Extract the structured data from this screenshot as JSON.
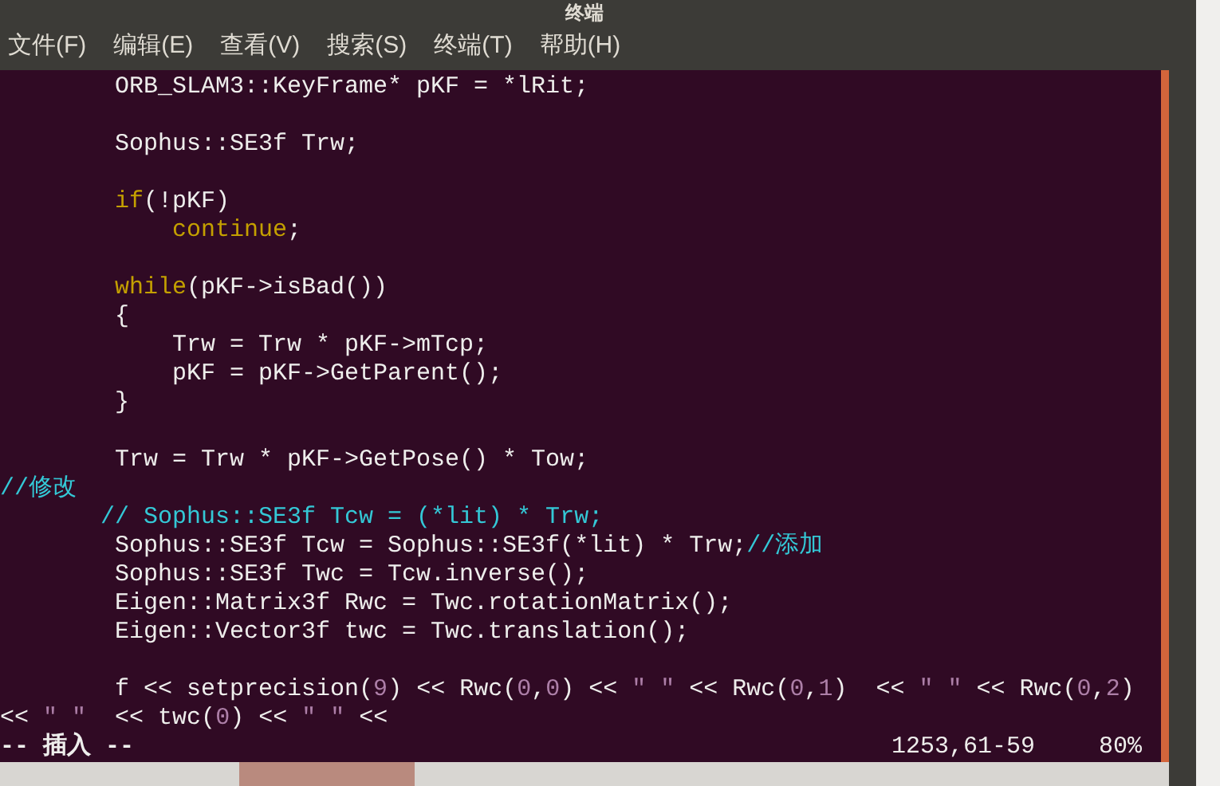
{
  "window": {
    "title": "终端"
  },
  "menu": [
    "文件(F)",
    "编辑(E)",
    "查看(V)",
    "搜索(S)",
    "终端(T)",
    "帮助(H)"
  ],
  "lines": [
    {
      "kind": "code",
      "segments": [
        {
          "kind": "plain",
          "text": "        ORB_SLAM3::KeyFrame* pKF = *lRit;"
        }
      ]
    },
    {
      "kind": "blank"
    },
    {
      "kind": "code",
      "segments": [
        {
          "kind": "plain",
          "text": "        Sophus::SE3f Trw;"
        }
      ]
    },
    {
      "kind": "blank"
    },
    {
      "kind": "code",
      "segments": [
        {
          "kind": "keyword",
          "text": "        if"
        },
        {
          "kind": "plain",
          "text": "(!pKF)"
        }
      ]
    },
    {
      "kind": "code",
      "segments": [
        {
          "kind": "keyword",
          "text": "            continue"
        },
        {
          "kind": "plain",
          "text": ";"
        }
      ]
    },
    {
      "kind": "blank"
    },
    {
      "kind": "code",
      "segments": [
        {
          "kind": "keyword",
          "text": "        while"
        },
        {
          "kind": "plain",
          "text": "(pKF->isBad())"
        }
      ]
    },
    {
      "kind": "code",
      "segments": [
        {
          "kind": "plain",
          "text": "        {"
        }
      ]
    },
    {
      "kind": "code",
      "segments": [
        {
          "kind": "plain",
          "text": "            Trw = Trw * pKF->mTcp;"
        }
      ]
    },
    {
      "kind": "code",
      "segments": [
        {
          "kind": "plain",
          "text": "            pKF = pKF->GetParent();"
        }
      ]
    },
    {
      "kind": "code",
      "segments": [
        {
          "kind": "plain",
          "text": "        }"
        }
      ]
    },
    {
      "kind": "blank"
    },
    {
      "kind": "code",
      "segments": [
        {
          "kind": "plain",
          "text": "        Trw = Trw * pKF->GetPose() * Tow;"
        }
      ]
    },
    {
      "kind": "code",
      "segments": [
        {
          "kind": "comment",
          "text": "//修改"
        }
      ]
    },
    {
      "kind": "code",
      "segments": [
        {
          "kind": "comment",
          "text": "       // Sophus::SE3f Tcw = (*lit) * Trw;"
        }
      ]
    },
    {
      "kind": "code",
      "segments": [
        {
          "kind": "plain",
          "text": "        Sophus::SE3f Tcw = Sophus::SE3f(*lit) * Trw;"
        },
        {
          "kind": "comment",
          "text": "//添加"
        }
      ]
    },
    {
      "kind": "code",
      "segments": [
        {
          "kind": "plain",
          "text": "        Sophus::SE3f Twc = Tcw.inverse();"
        }
      ]
    },
    {
      "kind": "code",
      "segments": [
        {
          "kind": "plain",
          "text": "        Eigen::Matrix3f Rwc = Twc.rotationMatrix();"
        }
      ]
    },
    {
      "kind": "code",
      "segments": [
        {
          "kind": "plain",
          "text": "        Eigen::Vector3f twc = Twc.translation();"
        }
      ]
    },
    {
      "kind": "blank"
    },
    {
      "kind": "code",
      "segments": [
        {
          "kind": "plain",
          "text": "        f << setprecision("
        },
        {
          "kind": "number",
          "text": "9"
        },
        {
          "kind": "plain",
          "text": ") << Rwc("
        },
        {
          "kind": "number",
          "text": "0"
        },
        {
          "kind": "plain",
          "text": ","
        },
        {
          "kind": "number",
          "text": "0"
        },
        {
          "kind": "plain",
          "text": ") << "
        },
        {
          "kind": "string",
          "text": "\" \""
        },
        {
          "kind": "plain",
          "text": " << Rwc("
        },
        {
          "kind": "number",
          "text": "0"
        },
        {
          "kind": "plain",
          "text": ","
        },
        {
          "kind": "number",
          "text": "1"
        },
        {
          "kind": "plain",
          "text": ")  << "
        },
        {
          "kind": "string",
          "text": "\" \""
        },
        {
          "kind": "plain",
          "text": " << Rwc("
        },
        {
          "kind": "number",
          "text": "0"
        },
        {
          "kind": "plain",
          "text": ","
        },
        {
          "kind": "number",
          "text": "2"
        },
        {
          "kind": "plain",
          "text": ")"
        }
      ]
    },
    {
      "kind": "code",
      "segments": [
        {
          "kind": "plain",
          "text": "<< "
        },
        {
          "kind": "string",
          "text": "\" \""
        },
        {
          "kind": "plain",
          "text": "  << twc("
        },
        {
          "kind": "number",
          "text": "0"
        },
        {
          "kind": "plain",
          "text": ") << "
        },
        {
          "kind": "string",
          "text": "\" \""
        },
        {
          "kind": "plain",
          "text": " <<"
        }
      ]
    }
  ],
  "status": {
    "mode": "-- 插入 --",
    "position": "1253,61-59",
    "percent": "80%"
  }
}
